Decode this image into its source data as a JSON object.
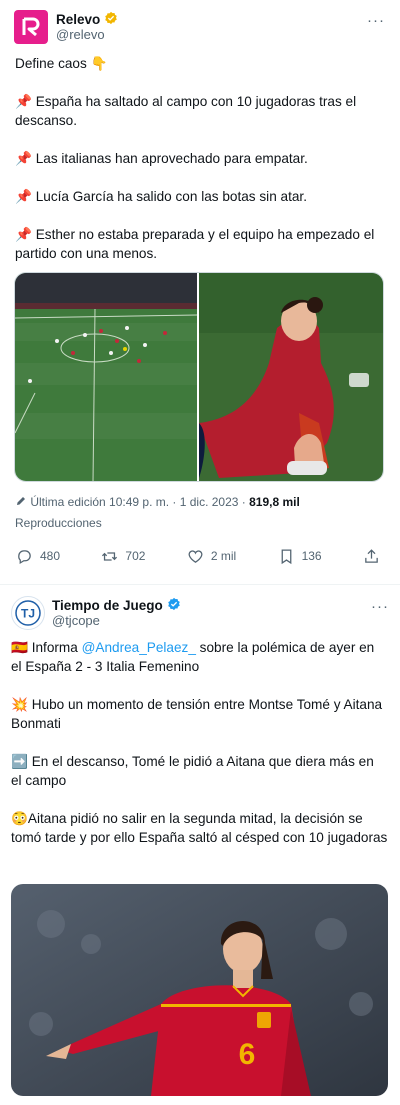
{
  "tweets": [
    {
      "author": "Relevo",
      "handle": "@relevo",
      "paragraphs": [
        "Define caos 👇",
        "📌 España ha saltado al campo con 10 jugadoras tras el descanso.",
        "📌 Las italianas han aprovechado para empatar.",
        "📌 Lucía García ha salido con las botas sin atar.",
        "📌 Esther no estaba preparada y el equipo ha empezado el partido con una menos."
      ],
      "edited_label": "Última edición 10:49 p. m. · 1 dic. 2023 ·",
      "views": "819,8 mil",
      "views_label": "Reproducciones",
      "stats": {
        "replies": "480",
        "retweets": "702",
        "likes": "2 mil",
        "bookmarks": "136"
      }
    },
    {
      "author": "Tiempo de Juego",
      "handle": "@tjcope",
      "p1_prefix": "🇪🇸 Informa ",
      "p1_mention": "@Andrea_Pelaez_",
      "p1_suffix": " sobre la polémica de ayer en el España 2 - 3 Italia Femenino",
      "paragraphs": [
        "💥 Hubo un momento de tensión entre Montse Tomé y Aitana Bonmati",
        "➡️ En el descanso, Tomé le pidió a Aitana que diera más en el campo",
        "😳Aitana pidió no salir en la segunda mitad, la decisión se tomó tarde y por ello España saltó al césped con 10 jugadoras"
      ],
      "jersey_number": "6"
    }
  ],
  "colors": {
    "brand_relevo": "#e61e8c",
    "verified": "#f2b600",
    "verified_blue": "#1d9bf0",
    "link": "#1d9bf0",
    "muted": "#536471"
  },
  "icons": [
    "relevo-logo-icon",
    "verified-badge-icon",
    "more-icon",
    "edit-pencil-icon",
    "reply-icon",
    "retweet-icon",
    "like-icon",
    "bookmark-icon",
    "share-icon"
  ]
}
